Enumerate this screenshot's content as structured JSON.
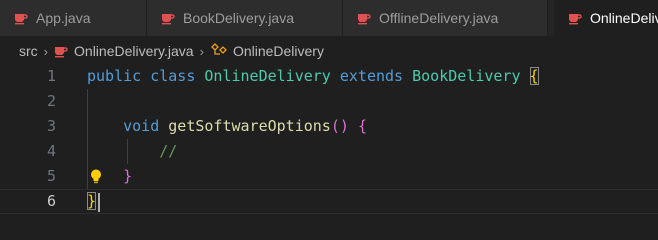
{
  "tabs": [
    {
      "label": "App.java",
      "active": false
    },
    {
      "label": "BookDelivery.java",
      "active": false
    },
    {
      "label": "OfflineDelivery.java",
      "active": false
    },
    {
      "label": "OnlineDelivery.java",
      "active": true
    }
  ],
  "breadcrumb": {
    "folder": "src",
    "file": "OnlineDelivery.java",
    "symbol": "OnlineDelivery"
  },
  "lines": [
    {
      "number": "1"
    },
    {
      "number": "2"
    },
    {
      "number": "3"
    },
    {
      "number": "4"
    },
    {
      "number": "5"
    },
    {
      "number": "6"
    }
  ],
  "code": {
    "l1": {
      "public": "public",
      "class": "class",
      "name": "OnlineDelivery",
      "extends": "extends",
      "parent": "BookDelivery",
      "open": "{"
    },
    "l3": {
      "void": "void",
      "method": "getSoftwareOptions",
      "parens": "()",
      "open": "{"
    },
    "l4": {
      "comment": "//"
    },
    "l5": {
      "close": "}"
    },
    "l6": {
      "close": "}"
    }
  },
  "colors": {
    "java_icon": "#e05252",
    "keyword": "#569cd6",
    "class": "#4ec9b0",
    "function": "#dcdcaa",
    "comment": "#6a9955",
    "bracket_level1": "#ffd700",
    "bracket_level2": "#da70d6"
  },
  "icons": {
    "tab_file": "java-coffee-icon",
    "breadcrumb_symbol": "class-symbol-icon",
    "gutter": "lightbulb-icon"
  }
}
